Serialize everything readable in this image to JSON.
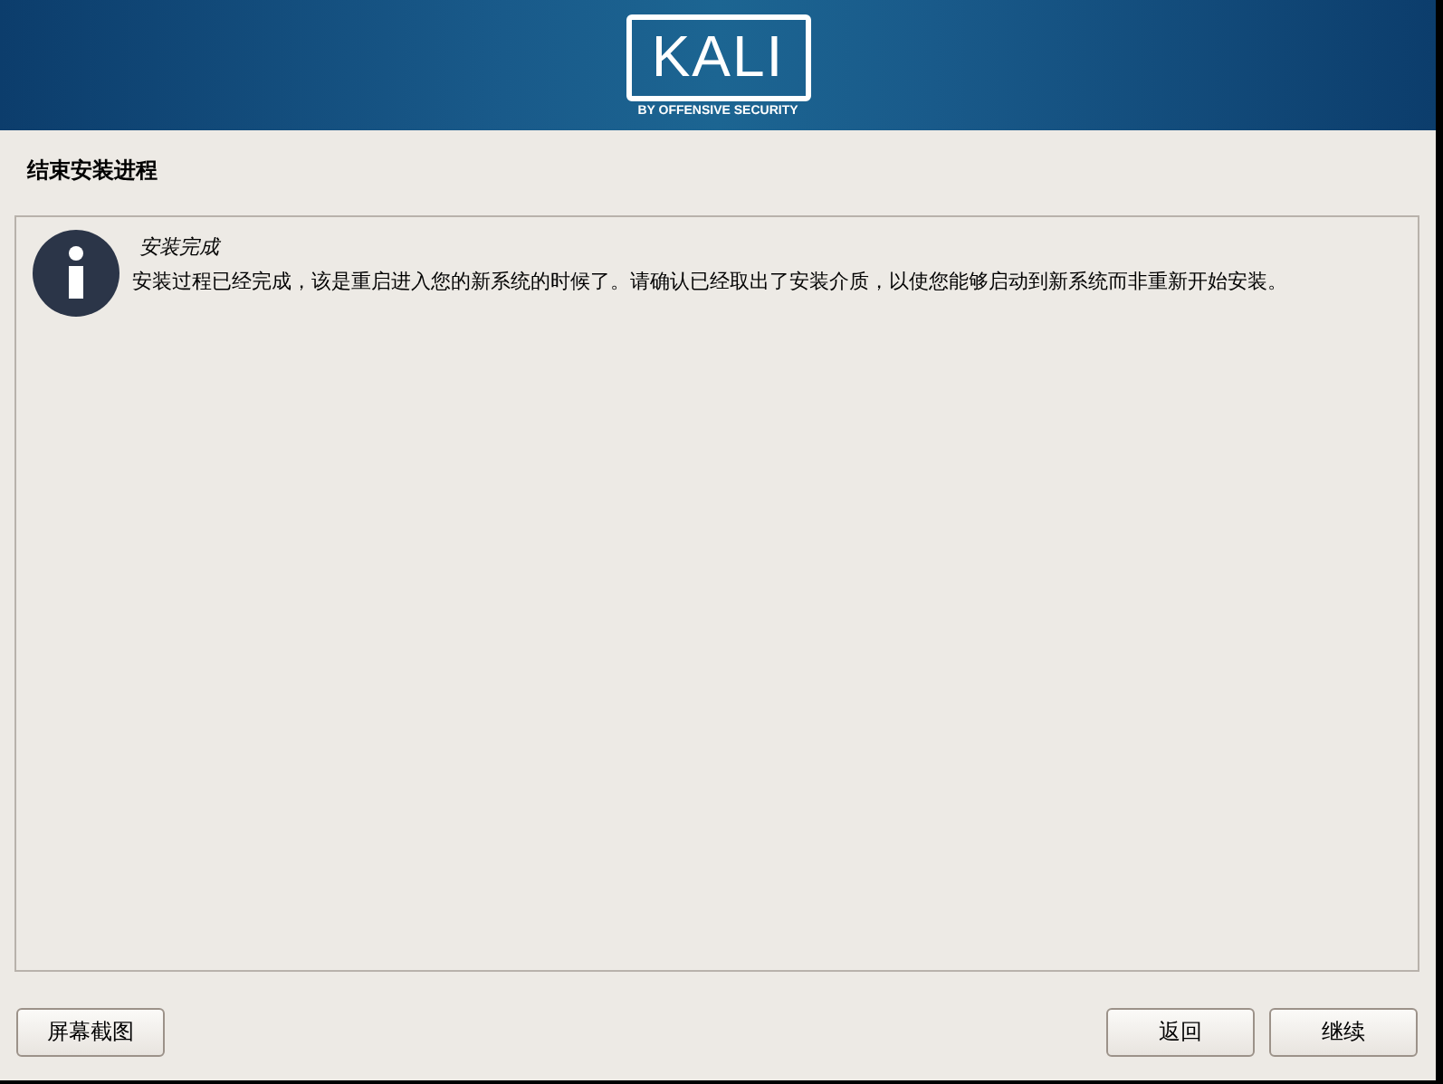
{
  "banner": {
    "logo_text": "KALI",
    "logo_subtitle": "BY OFFENSIVE SECURITY"
  },
  "page_title": "结束安装进程",
  "message": {
    "kind": "info",
    "title": "安装完成",
    "body": "安装过程已经完成，该是重启进入您的新系统的时候了。请确认已经取出了安装介质，以使您能够启动到新系统而非重新开始安装。"
  },
  "buttons": {
    "left": [
      "屏幕截图"
    ],
    "right": [
      "返回",
      "继续"
    ]
  }
}
